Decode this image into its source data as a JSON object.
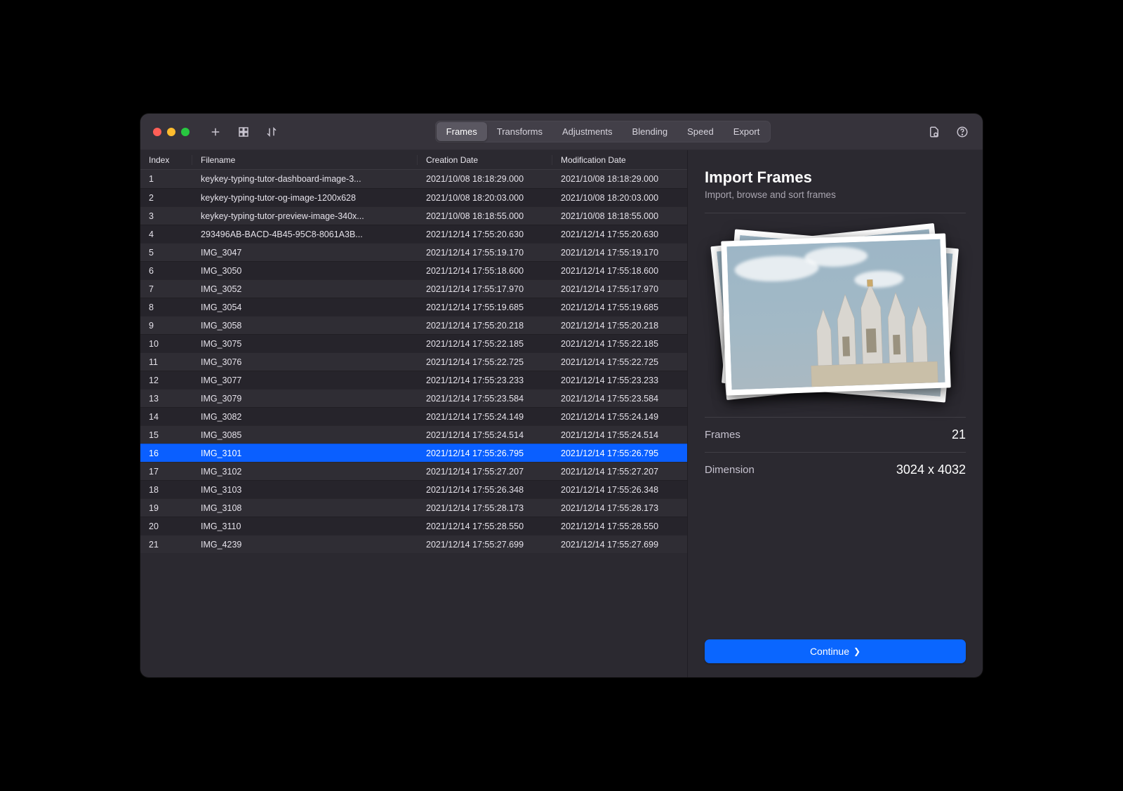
{
  "tabs": [
    "Frames",
    "Transforms",
    "Adjustments",
    "Blending",
    "Speed",
    "Export"
  ],
  "active_tab": 0,
  "columns": {
    "index": "Index",
    "filename": "Filename",
    "creation": "Creation Date",
    "modification": "Modification Date"
  },
  "selected_index": 15,
  "rows": [
    {
      "n": "1",
      "f": "keykey-typing-tutor-dashboard-image-3...",
      "c": "2021/10/08 18:18:29.000",
      "m": "2021/10/08 18:18:29.000"
    },
    {
      "n": "2",
      "f": "keykey-typing-tutor-og-image-1200x628",
      "c": "2021/10/08 18:20:03.000",
      "m": "2021/10/08 18:20:03.000"
    },
    {
      "n": "3",
      "f": "keykey-typing-tutor-preview-image-340x...",
      "c": "2021/10/08 18:18:55.000",
      "m": "2021/10/08 18:18:55.000"
    },
    {
      "n": "4",
      "f": "293496AB-BACD-4B45-95C8-8061A3B...",
      "c": "2021/12/14 17:55:20.630",
      "m": "2021/12/14 17:55:20.630"
    },
    {
      "n": "5",
      "f": "IMG_3047",
      "c": "2021/12/14 17:55:19.170",
      "m": "2021/12/14 17:55:19.170"
    },
    {
      "n": "6",
      "f": "IMG_3050",
      "c": "2021/12/14 17:55:18.600",
      "m": "2021/12/14 17:55:18.600"
    },
    {
      "n": "7",
      "f": "IMG_3052",
      "c": "2021/12/14 17:55:17.970",
      "m": "2021/12/14 17:55:17.970"
    },
    {
      "n": "8",
      "f": "IMG_3054",
      "c": "2021/12/14 17:55:19.685",
      "m": "2021/12/14 17:55:19.685"
    },
    {
      "n": "9",
      "f": "IMG_3058",
      "c": "2021/12/14 17:55:20.218",
      "m": "2021/12/14 17:55:20.218"
    },
    {
      "n": "10",
      "f": "IMG_3075",
      "c": "2021/12/14 17:55:22.185",
      "m": "2021/12/14 17:55:22.185"
    },
    {
      "n": "11",
      "f": "IMG_3076",
      "c": "2021/12/14 17:55:22.725",
      "m": "2021/12/14 17:55:22.725"
    },
    {
      "n": "12",
      "f": "IMG_3077",
      "c": "2021/12/14 17:55:23.233",
      "m": "2021/12/14 17:55:23.233"
    },
    {
      "n": "13",
      "f": "IMG_3079",
      "c": "2021/12/14 17:55:23.584",
      "m": "2021/12/14 17:55:23.584"
    },
    {
      "n": "14",
      "f": "IMG_3082",
      "c": "2021/12/14 17:55:24.149",
      "m": "2021/12/14 17:55:24.149"
    },
    {
      "n": "15",
      "f": "IMG_3085",
      "c": "2021/12/14 17:55:24.514",
      "m": "2021/12/14 17:55:24.514"
    },
    {
      "n": "16",
      "f": "IMG_3101",
      "c": "2021/12/14 17:55:26.795",
      "m": "2021/12/14 17:55:26.795"
    },
    {
      "n": "17",
      "f": "IMG_3102",
      "c": "2021/12/14 17:55:27.207",
      "m": "2021/12/14 17:55:27.207"
    },
    {
      "n": "18",
      "f": "IMG_3103",
      "c": "2021/12/14 17:55:26.348",
      "m": "2021/12/14 17:55:26.348"
    },
    {
      "n": "19",
      "f": "IMG_3108",
      "c": "2021/12/14 17:55:28.173",
      "m": "2021/12/14 17:55:28.173"
    },
    {
      "n": "20",
      "f": "IMG_3110",
      "c": "2021/12/14 17:55:28.550",
      "m": "2021/12/14 17:55:28.550"
    },
    {
      "n": "21",
      "f": "IMG_4239",
      "c": "2021/12/14 17:55:27.699",
      "m": "2021/12/14 17:55:27.699"
    }
  ],
  "sidebar": {
    "title": "Import Frames",
    "subtitle": "Import, browse and sort frames",
    "frames_label": "Frames",
    "frames_value": "21",
    "dimension_label": "Dimension",
    "dimension_value": "3024 x 4032",
    "continue": "Continue"
  }
}
